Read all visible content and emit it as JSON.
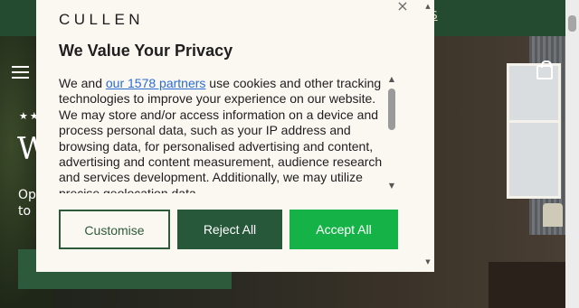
{
  "topbar": {
    "link_text": "S"
  },
  "hero": {
    "stars": "★★",
    "heading": "W",
    "subtext": "Op to ."
  },
  "dialog": {
    "brand": "CULLEN",
    "title": "We Value Your Privacy",
    "body_prefix": "We and ",
    "partners_link": "our 1578 partners",
    "body_rest": " use cookies and other tracking technologies to improve your experience on our website. We may store and/or access information on a device and process personal data, such as your IP address and browsing data, for personalised advertising and content, advertising and content measurement, audience research and services development. Additionally, we may utilize precise geolocation data",
    "close_icon": "×",
    "buttons": {
      "customise": "Customise",
      "reject": "Reject All",
      "accept": "Accept All"
    }
  },
  "colors": {
    "brand_green": "#2d5a3a",
    "reject_green": "#27583a",
    "accept_green": "#14b247",
    "link_blue": "#2a6bd6",
    "dialog_bg": "#fbf8f2",
    "topbar": "#244a30"
  }
}
